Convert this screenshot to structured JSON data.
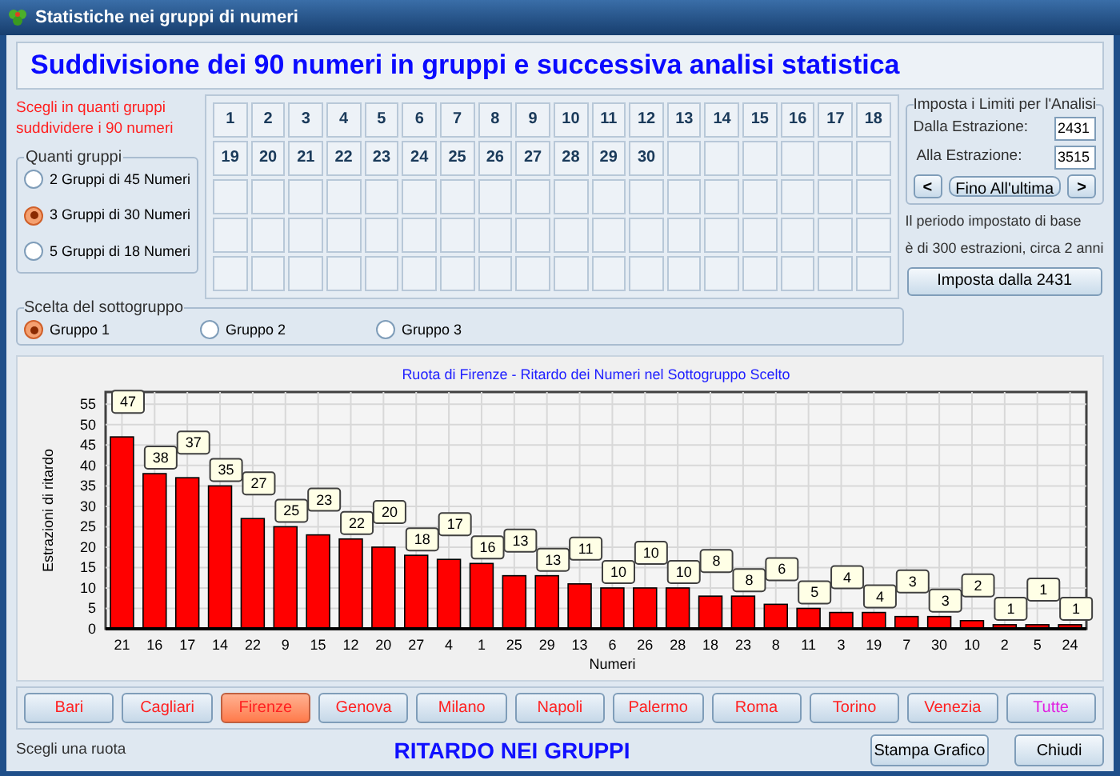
{
  "window": {
    "title": "Statistiche nei gruppi di numeri"
  },
  "heading": "Suddivisione dei 90 numeri in gruppi e successiva analisi statistica",
  "instruction": "Scegli in quanti gruppi suddividere i 90 numeri",
  "group_count": {
    "legend": "Quanti gruppi",
    "options": [
      {
        "label": "2 Gruppi di 45 Numeri",
        "selected": false
      },
      {
        "label": "3 Gruppi di 30 Numeri",
        "selected": true
      },
      {
        "label": "5 Gruppi di 18 Numeri",
        "selected": false
      }
    ]
  },
  "number_grid": {
    "cells": [
      "1",
      "2",
      "3",
      "4",
      "5",
      "6",
      "7",
      "8",
      "9",
      "10",
      "11",
      "12",
      "13",
      "14",
      "15",
      "16",
      "17",
      "18",
      "19",
      "20",
      "21",
      "22",
      "23",
      "24",
      "25",
      "26",
      "27",
      "28",
      "29",
      "30"
    ]
  },
  "limits": {
    "legend": "Imposta i Limiti per l'Analisi",
    "from_label": "Dalla Estrazione:",
    "from_value": "2431",
    "to_label": "Alla Estrazione:",
    "to_value": "3515",
    "prev": "<",
    "last_button": "Fino All'ultima",
    "next": ">"
  },
  "period_note": [
    "Il periodo impostato di base",
    "è di 300 estrazioni, circa 2 anni"
  ],
  "set_button": "Imposta dalla 2431",
  "subgroup": {
    "legend": "Scelta del sottogruppo",
    "options": [
      {
        "label": "Gruppo 1",
        "selected": true
      },
      {
        "label": "Gruppo 2",
        "selected": false
      },
      {
        "label": "Gruppo 3",
        "selected": false
      }
    ]
  },
  "chart": {
    "chart_data": {
      "type": "bar",
      "title": "Ruota di Firenze - Ritardo dei Numeri nel Sottogruppo Scelto",
      "xlabel": "Numeri",
      "ylabel": "Estrazioni di ritardo",
      "categories": [
        "21",
        "16",
        "17",
        "14",
        "22",
        "9",
        "15",
        "12",
        "20",
        "27",
        "4",
        "1",
        "25",
        "29",
        "13",
        "6",
        "26",
        "28",
        "18",
        "23",
        "8",
        "11",
        "3",
        "19",
        "7",
        "30",
        "10",
        "2",
        "5",
        "24"
      ],
      "series": [
        {
          "color": "#ff0000",
          "values": [
            47,
            38,
            37,
            35,
            27,
            25,
            23,
            22,
            20,
            18,
            17,
            16,
            13,
            13,
            11,
            10,
            10,
            10,
            8,
            8,
            6,
            5,
            4,
            4,
            3,
            3,
            2,
            1,
            1,
            1
          ]
        }
      ],
      "ylim": [
        0,
        58
      ],
      "yticks": [
        0,
        5,
        10,
        15,
        20,
        25,
        30,
        35,
        40,
        45,
        50,
        55
      ],
      "data_labels": true,
      "grid": true
    }
  },
  "wheels": [
    {
      "label": "Bari",
      "selected": false,
      "kind": "wheel"
    },
    {
      "label": "Cagliari",
      "selected": false,
      "kind": "wheel"
    },
    {
      "label": "Firenze",
      "selected": true,
      "kind": "wheel"
    },
    {
      "label": "Genova",
      "selected": false,
      "kind": "wheel"
    },
    {
      "label": "Milano",
      "selected": false,
      "kind": "wheel"
    },
    {
      "label": "Napoli",
      "selected": false,
      "kind": "wheel"
    },
    {
      "label": "Palermo",
      "selected": false,
      "kind": "wheel"
    },
    {
      "label": "Roma",
      "selected": false,
      "kind": "wheel"
    },
    {
      "label": "Torino",
      "selected": false,
      "kind": "wheel"
    },
    {
      "label": "Venezia",
      "selected": false,
      "kind": "wheel"
    },
    {
      "label": "Tutte",
      "selected": false,
      "kind": "all"
    }
  ],
  "status": "Scegli una ruota",
  "footer_title": "RITARDO NEI GRUPPI",
  "print_button": "Stampa Grafico",
  "close_button": "Chiudi"
}
